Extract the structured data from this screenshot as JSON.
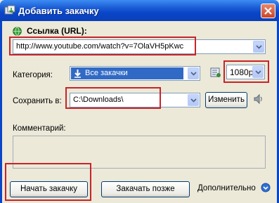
{
  "window": {
    "title": "Добавить закачку"
  },
  "url": {
    "label": "Ссылка (URL):",
    "value": "http://www.youtube.com/watch?v=7OlaVH5pKwc"
  },
  "category": {
    "label": "Категория:",
    "value": "Все закачки"
  },
  "resolution": {
    "value": "1080p"
  },
  "save": {
    "label": "Сохранить в:",
    "path": "C:\\Downloads\\",
    "change_button": "Изменить"
  },
  "comment": {
    "label": "Комментарий:",
    "value": ""
  },
  "buttons": {
    "start": "Начать закачку",
    "later": "Закачать позже",
    "more": "Дополнительно"
  },
  "colors": {
    "highlight": "#c8232b",
    "titlebar": "#0a46c9",
    "selection": "#316ac5"
  }
}
